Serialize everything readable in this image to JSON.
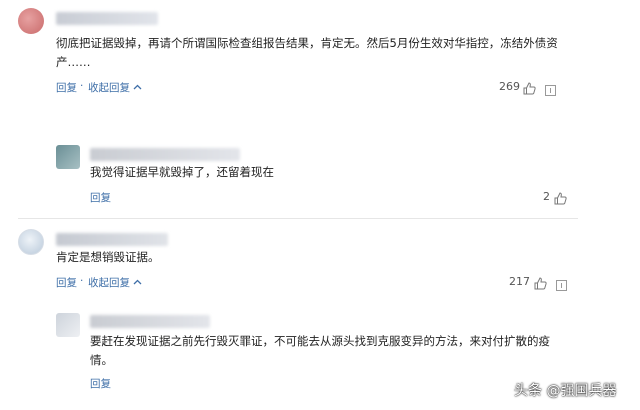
{
  "comments": [
    {
      "text": "彻底把证据毁掉，再请个所谓国际检查组报告结果，肯定无。然后5月份生效对华指控，冻结外债资产……",
      "reply_label": "回复",
      "collapse_label": "收起回复",
      "likes": "269",
      "replies": [
        {
          "text": "我觉得证据早就毁掉了，还留着现在",
          "reply_label": "回复",
          "likes": "2"
        }
      ]
    },
    {
      "text": "肯定是想销毁证据。",
      "reply_label": "回复",
      "collapse_label": "收起回复",
      "likes": "217",
      "replies": [
        {
          "text": "要赶在发现证据之前先行毁灭罪证，不可能去从源头找到克服变异的方法，来对付扩散的疫情。",
          "reply_label": "回复"
        }
      ]
    }
  ],
  "watermark": "头条 @强国兵器",
  "icons": {
    "like": "thumbs-up-icon",
    "more": "more-icon",
    "collapse": "chevron-up-icon"
  }
}
